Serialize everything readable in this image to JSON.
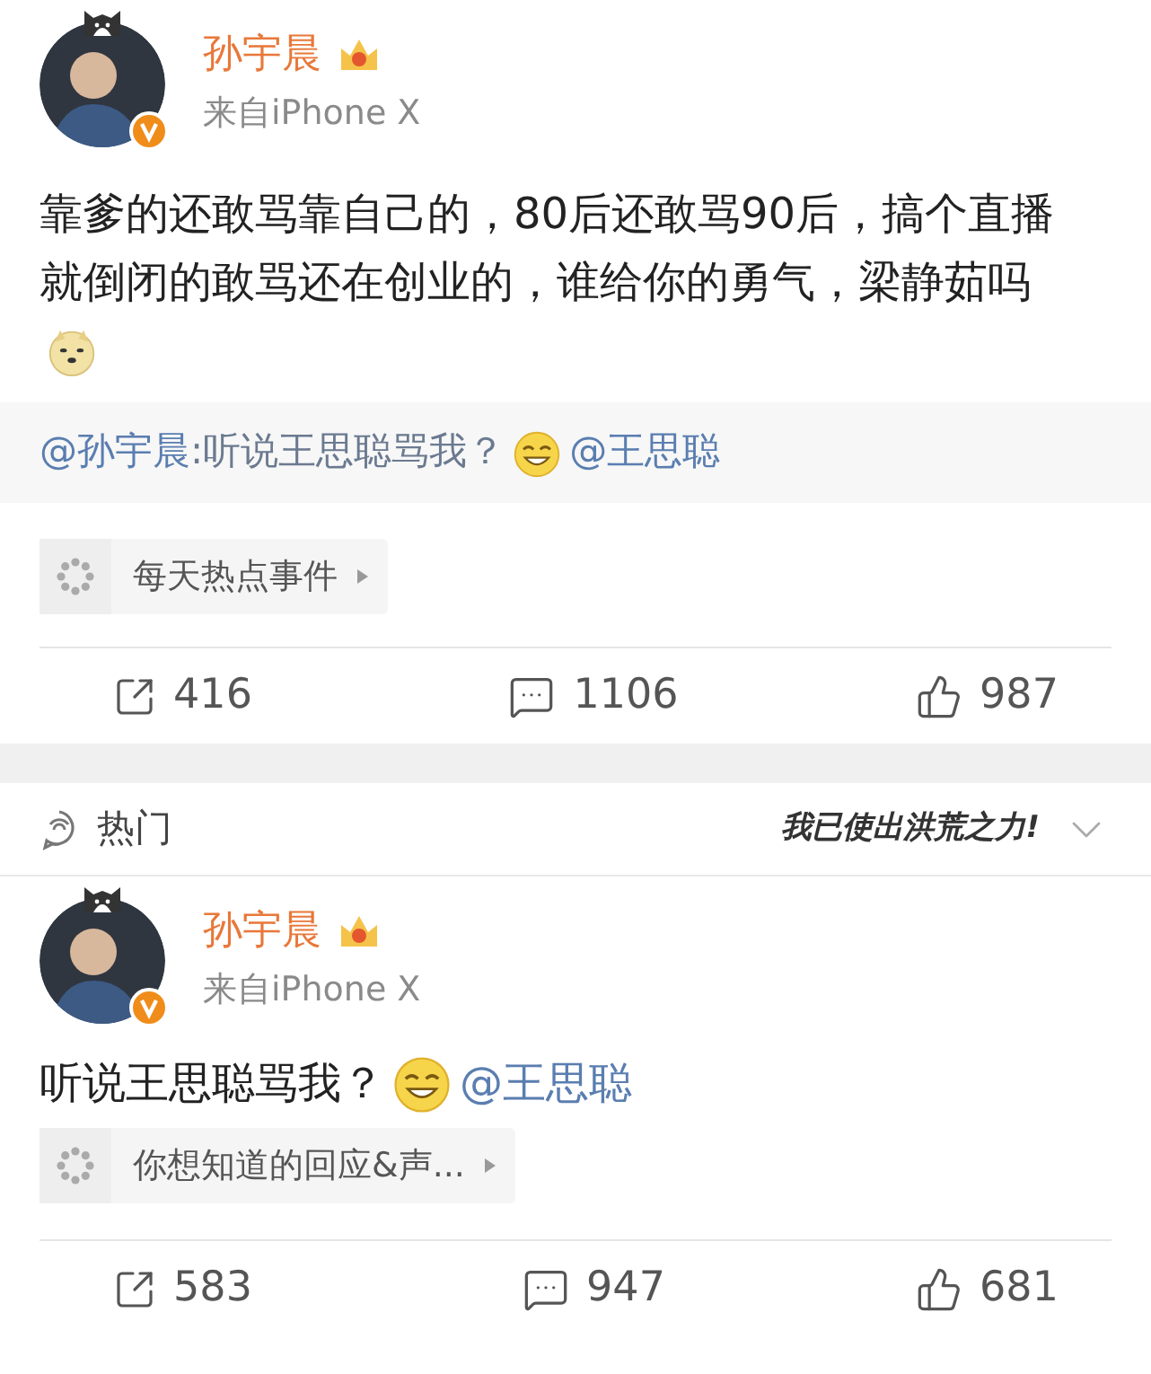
{
  "posts": [
    {
      "author": "孙宇晨",
      "source": "来自iPhone X",
      "verified": true,
      "body": [
        {
          "kind": "text",
          "text": "靠爹的还敢骂靠自己的，80后还敢骂90后，搞个直播就倒闭的敢骂还在创业的，谁给你的勇气，梁静茹吗"
        },
        {
          "kind": "doge"
        }
      ],
      "quote": [
        {
          "kind": "mention",
          "text": "@孙宇晨"
        },
        {
          "kind": "text",
          "text": ":听说王思聪骂我？"
        },
        {
          "kind": "grin"
        },
        {
          "kind": "mention",
          "text": "@王思聪"
        }
      ],
      "topic": "每天热点事件",
      "actions": {
        "reposts": "416",
        "comments": "1106",
        "likes": "987"
      }
    },
    {
      "author": "孙宇晨",
      "source": "来自iPhone X",
      "verified": true,
      "body": [
        {
          "kind": "text",
          "text": "听说王思聪骂我？"
        },
        {
          "kind": "grin"
        },
        {
          "kind": "mention",
          "text": "@王思聪"
        }
      ],
      "topic": "你想知道的回应&声...",
      "actions": {
        "reposts": "583",
        "comments": "947",
        "likes": "681"
      }
    }
  ],
  "hot_header": {
    "label": "热门",
    "sticker": "我已使出洪荒之力!"
  }
}
